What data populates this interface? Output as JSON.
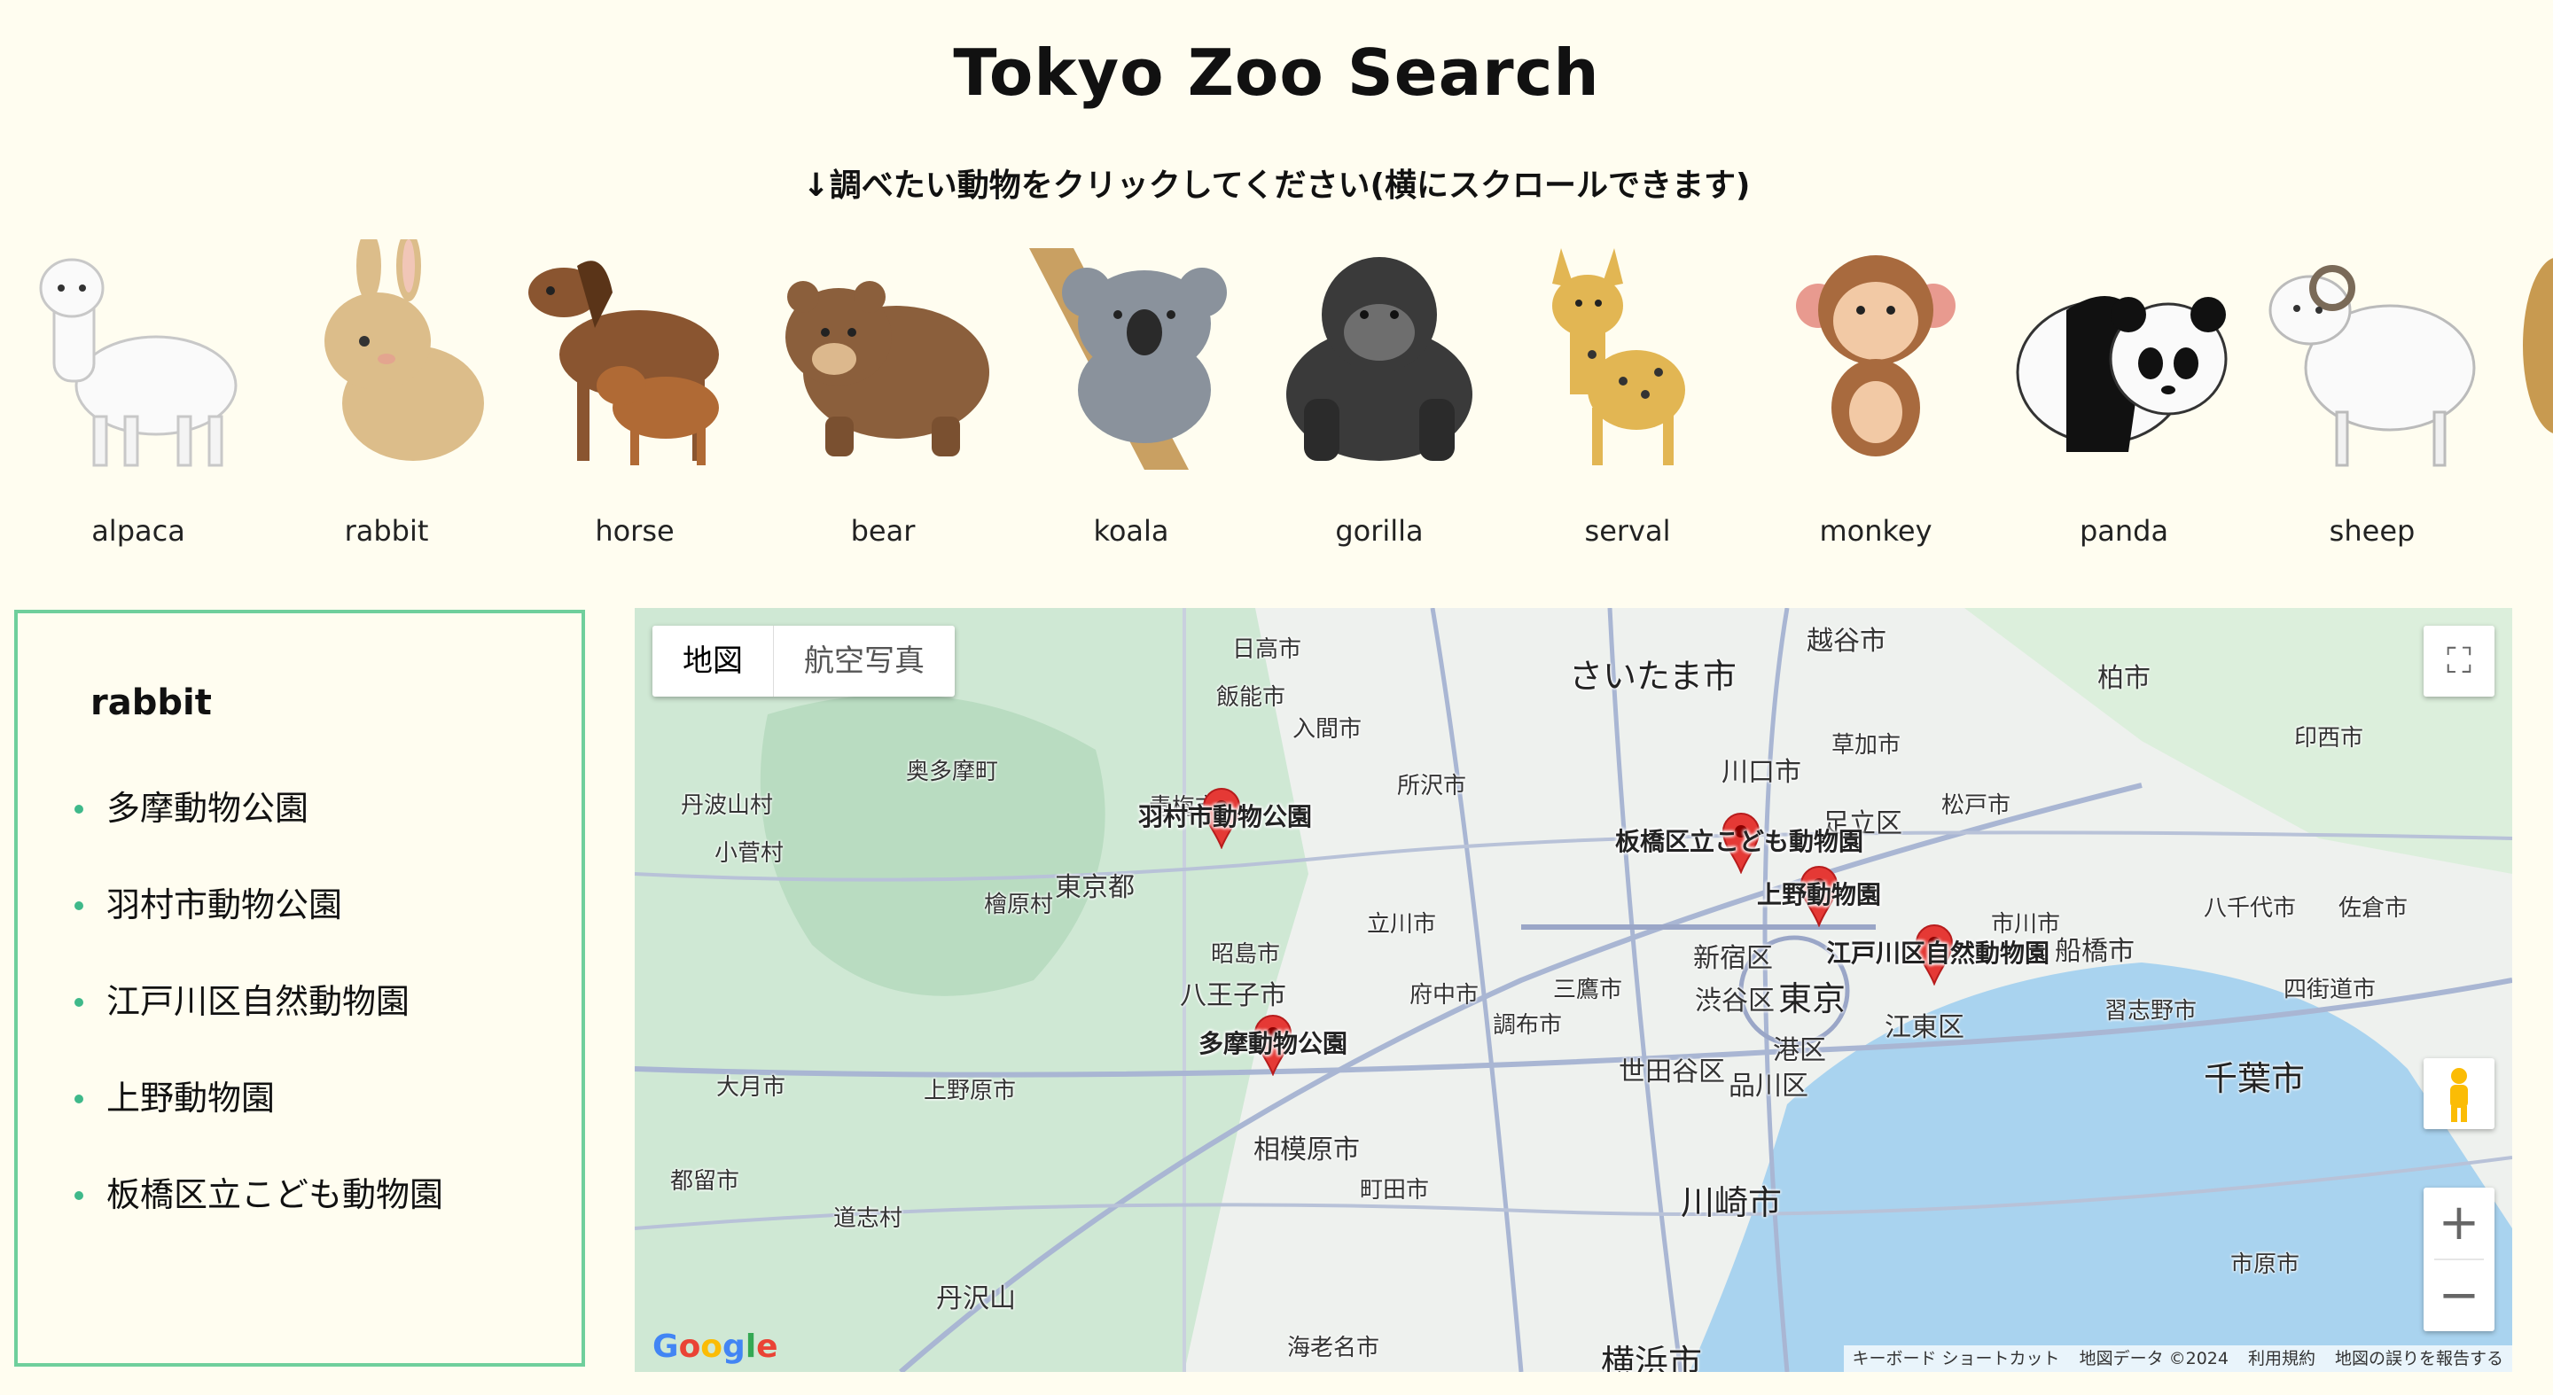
{
  "header": {
    "title": "Tokyo Zoo Search",
    "subtitle": "↓調べたい動物をクリックしてください(横にスクロールできます)"
  },
  "animals": [
    {
      "name": "alpaca",
      "icon": "alpaca-icon"
    },
    {
      "name": "rabbit",
      "icon": "rabbit-icon"
    },
    {
      "name": "horse",
      "icon": "horse-icon"
    },
    {
      "name": "bear",
      "icon": "bear-icon"
    },
    {
      "name": "koala",
      "icon": "koala-icon"
    },
    {
      "name": "gorilla",
      "icon": "gorilla-icon"
    },
    {
      "name": "serval",
      "icon": "serval-icon"
    },
    {
      "name": "monkey",
      "icon": "monkey-icon"
    },
    {
      "name": "panda",
      "icon": "panda-icon"
    },
    {
      "name": "sheep",
      "icon": "sheep-icon"
    }
  ],
  "results": {
    "selected_animal": "rabbit",
    "zoos": [
      "多摩動物公園",
      "羽村市動物公園",
      "江戸川区自然動物園",
      "上野動物園",
      "板橋区立こども動物園"
    ]
  },
  "map": {
    "type_buttons": [
      "地図",
      "航空写真"
    ],
    "active_type": "地図",
    "markers": [
      "羽村市動物公園",
      "板橋区立こども動物園",
      "上野動物園",
      "江戸川区自然動物園",
      "多摩動物公園"
    ],
    "place_labels": {
      "saitama": "さいたま市",
      "tokyo_to": "東京都",
      "tokyo": "東京",
      "chiba": "千葉市",
      "kawasaki": "川崎市",
      "yokohama": "横浜市",
      "hachioji": "八王子市",
      "sagamihara": "相模原市",
      "kawaguchi": "川口市",
      "koshigaya": "越谷市",
      "kashiwa": "柏市",
      "shinjuku": "新宿区",
      "shibuya": "渋谷区",
      "minato": "港区",
      "setagaya": "世田谷区",
      "shinagawa": "品川区",
      "koto": "江東区",
      "adachi": "足立区",
      "funabashi": "船橋市",
      "tanzawa": "丹沢山",
      "okutama": "奥多摩町",
      "ome": "青梅市",
      "hino": "日高市",
      "hanno": "飯能市",
      "iruma": "入間市",
      "tokorozawa": "所沢市",
      "tachikawa": "立川市",
      "akishima": "昭島市",
      "fuchu": "府中市",
      "chofu": "調布市",
      "mitaka": "三鷹市",
      "machida": "町田市",
      "otsuki": "大月市",
      "uenohara": "上野原市",
      "kosuge": "小菅村",
      "tabayama": "丹波山村",
      "hinohara": "檜原村",
      "tsuru": "都留市",
      "doshi": "道志村",
      "matsudo": "松戸市",
      "ichikawa": "市川市",
      "yachiyo": "八千代市",
      "narashino": "習志野市",
      "yotsukaido": "四街道市",
      "sakura": "佐倉市",
      "inzai": "印西市",
      "ichihara": "市原市",
      "soka": "草加市",
      "ebina": "海老名市"
    },
    "controls": {
      "zoom_in": "+",
      "zoom_out": "−"
    },
    "attribution": {
      "logo": "Google",
      "shortcuts": "キーボード ショートカット",
      "data": "地図データ ©2024",
      "terms": "利用規約",
      "report": "地図の誤りを報告する"
    }
  },
  "colors": {
    "background": "#fffdf0",
    "panel_border": "#6fcf9c",
    "bullet": "#3fb98a",
    "marker": "#e53935"
  }
}
